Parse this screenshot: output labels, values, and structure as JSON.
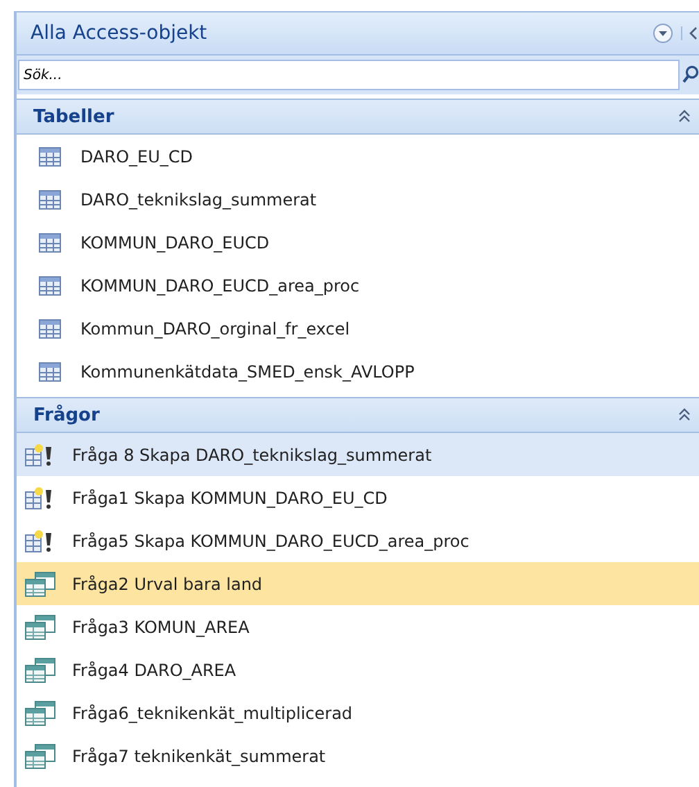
{
  "pane": {
    "title": "Alla Access-objekt"
  },
  "search": {
    "placeholder": "Sök..."
  },
  "groups": [
    {
      "title": "Tabeller",
      "expanded": true,
      "items": [
        {
          "kind": "table",
          "label": "DARO_EU_CD",
          "selected": false,
          "hovered": false
        },
        {
          "kind": "table",
          "label": "DARO_teknikslag_summerat",
          "selected": false,
          "hovered": false
        },
        {
          "kind": "table",
          "label": "KOMMUN_DARO_EUCD",
          "selected": false,
          "hovered": false
        },
        {
          "kind": "table",
          "label": "KOMMUN_DARO_EUCD_area_proc",
          "selected": false,
          "hovered": false
        },
        {
          "kind": "table",
          "label": "Kommun_DARO_orginal_fr_excel",
          "selected": false,
          "hovered": false
        },
        {
          "kind": "table",
          "label": "Kommunenkätdata_SMED_ensk_AVLOPP",
          "selected": false,
          "hovered": false
        }
      ]
    },
    {
      "title": "Frågor",
      "expanded": true,
      "items": [
        {
          "kind": "make-table",
          "label": "Fråga 8 Skapa DARO_teknikslag_summerat",
          "selected": false,
          "hovered": true
        },
        {
          "kind": "make-table",
          "label": "Fråga1 Skapa KOMMUN_DARO_EU_CD",
          "selected": false,
          "hovered": false
        },
        {
          "kind": "make-table",
          "label": "Fråga5 Skapa KOMMUN_DARO_EUCD_area_proc",
          "selected": false,
          "hovered": false
        },
        {
          "kind": "select",
          "label": "Fråga2 Urval bara land",
          "selected": true,
          "hovered": false
        },
        {
          "kind": "select",
          "label": "Fråga3 KOMUN_AREA",
          "selected": false,
          "hovered": false
        },
        {
          "kind": "select",
          "label": "Fråga4 DARO_AREA",
          "selected": false,
          "hovered": false
        },
        {
          "kind": "select",
          "label": "Fråga6_teknikenkät_multiplicerad",
          "selected": false,
          "hovered": false
        },
        {
          "kind": "select",
          "label": "Fråga7 teknikenkät_summerat",
          "selected": false,
          "hovered": false
        }
      ]
    }
  ]
}
